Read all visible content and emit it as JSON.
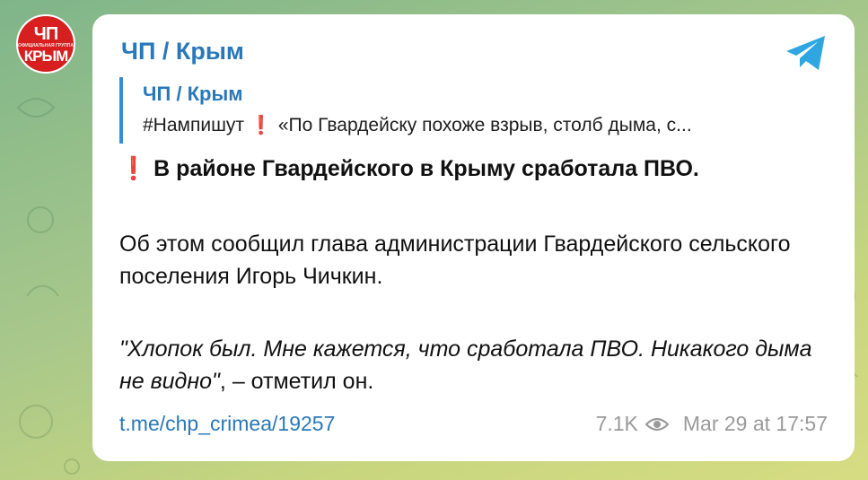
{
  "avatar": {
    "top_text": "ЧП",
    "small_text": "ОФИЦИАЛЬНАЯ ГРУППА",
    "bottom_text": "КРЫМ"
  },
  "post": {
    "channel_name": "ЧП / Крым",
    "reply": {
      "name": "ЧП / Крым",
      "tag": "#Нампишут",
      "excl": "❗",
      "text": "«По Гвардейску похоже взрыв, столб дыма, с..."
    },
    "headline_excl": "❗",
    "headline": "В районе Гвардейского в Крыму сработала ПВО.",
    "paragraph": "Об этом сообщил глава администрации Гвардейского сельского поселения Игорь Чичкин.",
    "quote_italic": "\"Хлопок был. Мне кажется, что сработала ПВО. Никакого дыма не видно\"",
    "quote_tail": ", – отметил он.",
    "link": "t.me/chp_crimea/19257",
    "views": "7.1K",
    "date": "Mar 29 at 17:57"
  },
  "icons": {
    "share": "telegram-plane-icon",
    "views": "eye-icon"
  },
  "colors": {
    "accent": "#2a78b8",
    "excl": "#e3162a",
    "avatar_bg": "#d71f1f",
    "telegram": "#2ea6e0"
  }
}
